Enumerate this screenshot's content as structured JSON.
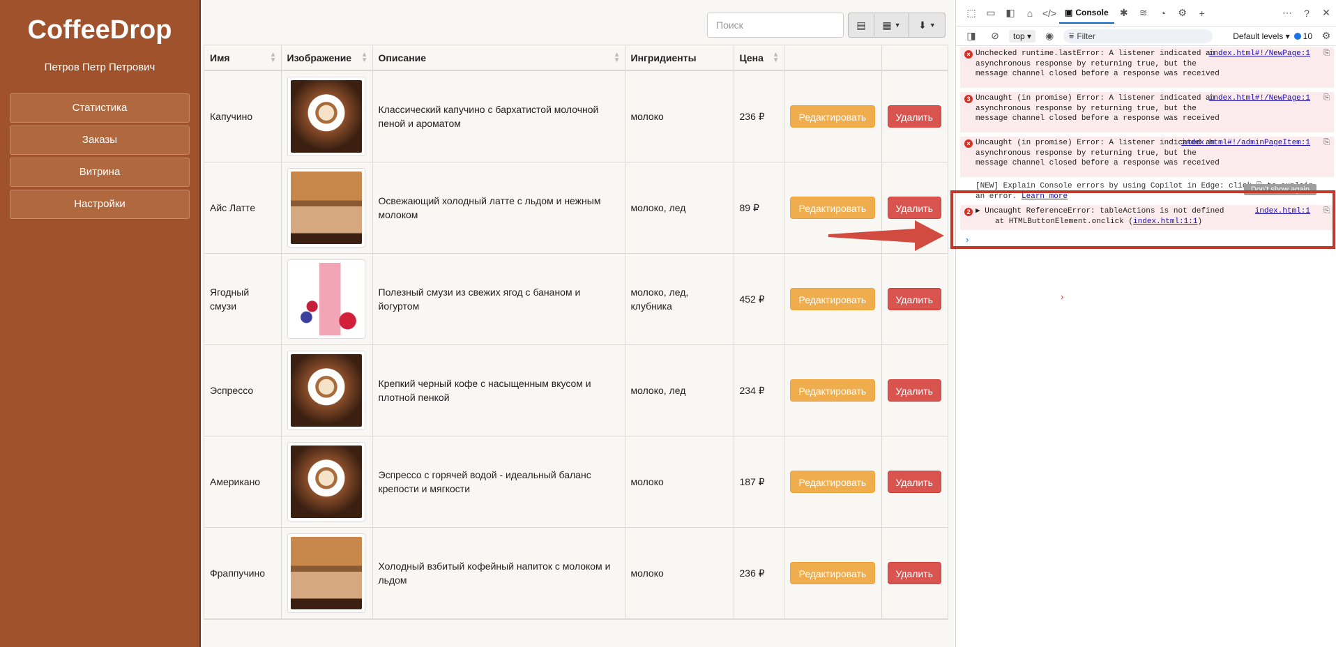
{
  "app": {
    "brand": "CoffeeDrop",
    "user": "Петров Петр Петрович"
  },
  "nav": [
    {
      "label": "Статистика"
    },
    {
      "label": "Заказы"
    },
    {
      "label": "Витрина"
    },
    {
      "label": "Настройки"
    }
  ],
  "search": {
    "placeholder": "Поиск"
  },
  "table": {
    "headers": {
      "name": "Имя",
      "image": "Изображение",
      "description": "Описание",
      "ingredients": "Ингридиенты",
      "price": "Цена"
    },
    "actions": {
      "edit": "Редактировать",
      "delete": "Удалить"
    },
    "rows": [
      {
        "name": "Капучино",
        "image": "cappuccino-photo",
        "description": "Классический капучино с бархатистой молочной пеной и ароматом",
        "ingredients": "молоко",
        "price": "236 ₽"
      },
      {
        "name": "Айс Латте",
        "image": "iced-latte-photo",
        "description": "Освежающий холодный латте с льдом и нежным молоком",
        "ingredients": "молоко, лед",
        "price": "89 ₽"
      },
      {
        "name": "Ягодный смузи",
        "image": "berry-smoothie-photo",
        "description": "Полезный смузи из свежих ягод с бананом и йогуртом",
        "ingredients": "молоко, лед, клубника",
        "price": "452 ₽"
      },
      {
        "name": "Эспрессо",
        "image": "cappuccino-photo",
        "description": "Крепкий черный кофе с насыщенным вкусом и плотной пенкой",
        "ingredients": "молоко, лед",
        "price": "234 ₽"
      },
      {
        "name": "Американо",
        "image": "cappuccino-photo",
        "description": "Эспрессо с горячей водой - идеальный баланс крепости и мягкости",
        "ingredients": "молоко",
        "price": "187 ₽"
      },
      {
        "name": "Фраппучино",
        "image": "iced-latte-photo",
        "description": "Холодный взбитый кофейный напиток с молоком и льдом",
        "ingredients": "молоко",
        "price": "236 ₽"
      }
    ]
  },
  "devtools": {
    "tab": "Console",
    "context": "top",
    "filter": "Filter",
    "levels": "Default levels",
    "issues": "10",
    "messages": [
      {
        "count": "×",
        "text": "Unchecked runtime.lastError: A listener indicated an asynchronous response by returning true, but the message channel closed before a response was received",
        "source": "index.html#!/NewPage:1"
      },
      {
        "count": "3",
        "text": "Uncaught (in promise) Error: A listener indicated an asynchronous response by returning true, but the message channel closed before a response was received",
        "source": "index.html#!/NewPage:1"
      },
      {
        "count": "×",
        "text": "Uncaught (in promise) Error: A listener indicated an asynchronous response by returning true, but the message channel closed before a response was received",
        "source": "index.html#!/adminPageItem:1"
      },
      {
        "count": "2",
        "text": "▶ Uncaught ReferenceError: tableActions is not defined",
        "text2": "at HTMLButtonElement.onclick (",
        "link2": "index.html:1:1",
        "text3": ")",
        "source": "index.html:1"
      }
    ],
    "info": {
      "text": "[NEW] Explain Console errors by using Copilot in Edge: click",
      "text2": "to explain an error.",
      "learn": "Learn more",
      "dismiss": "Don't show again"
    }
  },
  "colors": {
    "sidebar": "#a0522d",
    "edit": "#f0ad4e",
    "delete": "#d9534f",
    "highlight": "#c0392b"
  }
}
